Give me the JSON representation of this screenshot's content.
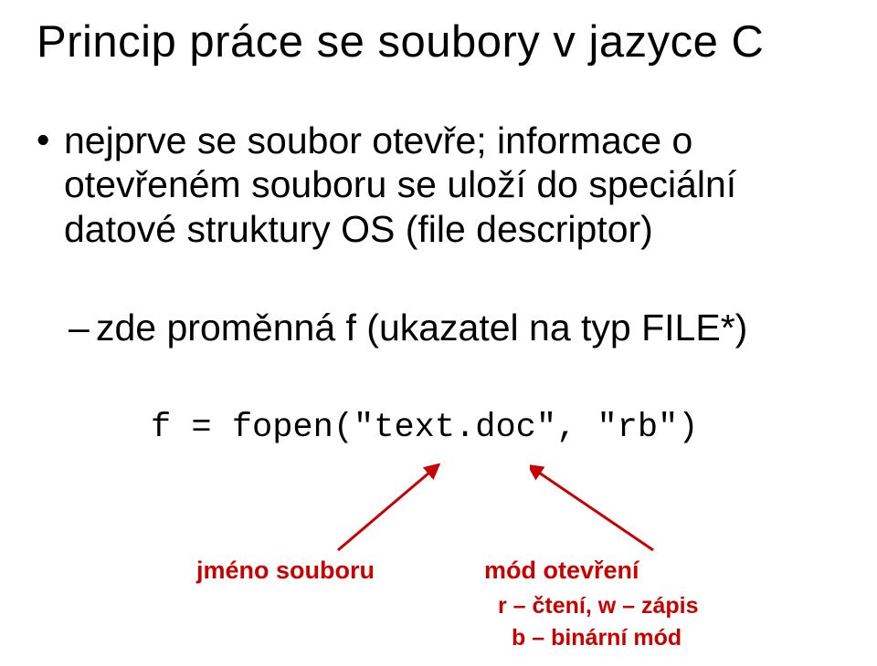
{
  "title": "Princip práce se soubory v jazyce C",
  "bullet1_text": "nejprve se soubor otevře; informace o\notevřeném souboru se uloží do speciální\ndatové struktury OS (file descriptor)",
  "sub1_text": "zde proměnná f (ukazatel na typ FILE*)",
  "code": "f = fopen(″text.doc″, ″rb″)",
  "caption_left": "jméno souboru",
  "caption_right": "mód otevření",
  "mode_line2": "r – čtení, w – zápis",
  "mode_line3": "b – binární mód"
}
